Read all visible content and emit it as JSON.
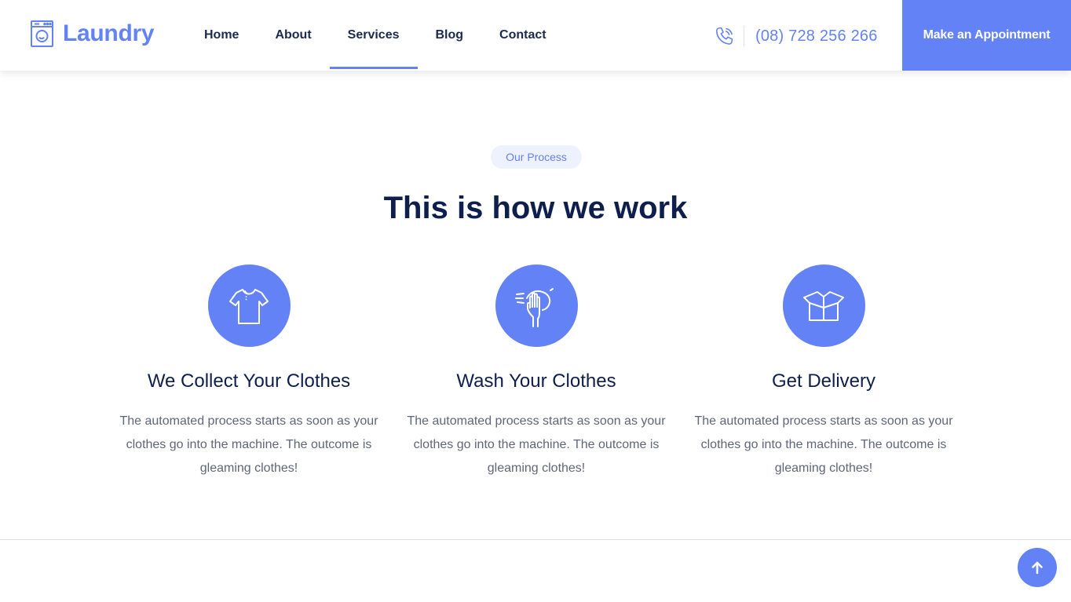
{
  "brand": {
    "name": "Laundry",
    "logo_icon": "washing-machine-icon",
    "accent": "#6382f5"
  },
  "nav": {
    "items": [
      {
        "label": "Home"
      },
      {
        "label": "About"
      },
      {
        "label": "Services"
      },
      {
        "label": "Blog"
      },
      {
        "label": "Contact"
      }
    ],
    "active": "Services"
  },
  "header": {
    "phone": "(08) 728 256 266",
    "phone_icon": "phone-icon",
    "cta_label": "Make an Appointment"
  },
  "process": {
    "badge": "Our Process",
    "title": "This is how we work",
    "steps": [
      {
        "icon": "tshirt-icon",
        "title": "We Collect Your Clothes",
        "text": "The automated process starts as soon as your clothes go into the machine. The outcome is gleaming clothes!"
      },
      {
        "icon": "hand-wash-icon",
        "title": "Wash Your Clothes",
        "text": "The automated process starts as soon as your clothes go into the machine. The outcome is gleaming clothes!"
      },
      {
        "icon": "box-icon",
        "title": "Get Delivery",
        "text": "The automated process starts as soon as your clothes go into the machine. The outcome is gleaming clothes!"
      }
    ]
  },
  "scroll_top_icon": "arrow-up-icon"
}
